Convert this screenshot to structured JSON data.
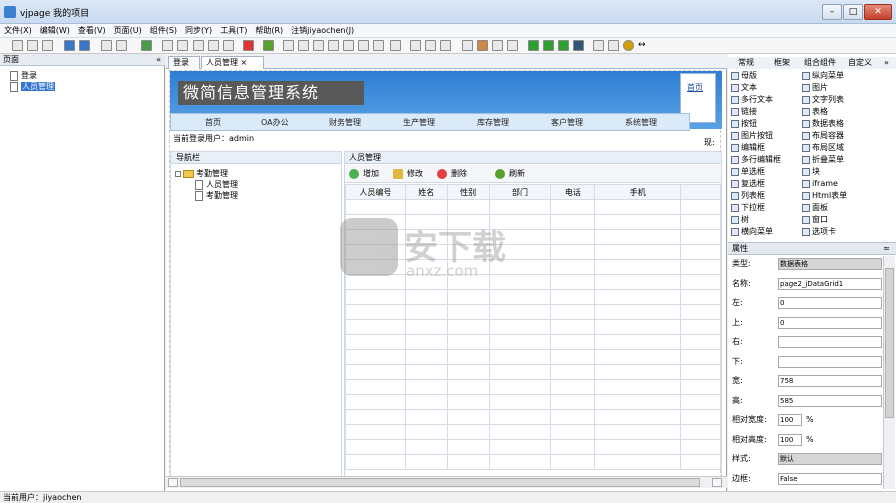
{
  "window": {
    "title": "vjpage 我的项目",
    "controls": [
      "–",
      "□",
      "✕"
    ]
  },
  "menu": [
    "文件(X)",
    "编辑(W)",
    "查看(V)",
    "页面(U)",
    "组件(S)",
    "同步(Y)",
    "工具(T)",
    "帮助(R)",
    "注销jiyaochen(J)"
  ],
  "left_panel": {
    "title": "页面",
    "collapse": "«",
    "items": [
      "登录",
      "人员管理"
    ]
  },
  "tabs": [
    {
      "label": "登录",
      "close": "×"
    },
    {
      "label": "人员管理",
      "close": "×"
    }
  ],
  "design": {
    "brand": "微简信息管理系统",
    "home_link": "首页",
    "nav": [
      "首页",
      "OA办公",
      "财务管理",
      "生产管理",
      "库存管理",
      "客户管理",
      "系统管理"
    ],
    "current_user": "当前登录用户：admin",
    "right_cut": "现:",
    "nav_panel": {
      "title": "导航栏",
      "root": "考勤管理",
      "children": [
        "人员管理",
        "考勤管理"
      ]
    },
    "grid_panel": {
      "title": "人员管理",
      "buttons": [
        "增加",
        "修改",
        "删除",
        "刷新"
      ],
      "columns": [
        "人员编号",
        "姓名",
        "性别",
        "部门",
        "电话",
        "手机"
      ]
    }
  },
  "right_panel": {
    "tabs": [
      "常规",
      "框架",
      "组合组件",
      "自定义"
    ],
    "more": "»",
    "components_col1": [
      "母版",
      "文本",
      "多行文本",
      "链接",
      "按钮",
      "图片按钮",
      "编辑框",
      "多行编辑框",
      "单选框",
      "复选框",
      "列表框",
      "下拉框",
      "树",
      "横向菜单"
    ],
    "components_col2": [
      "纵向菜单",
      "图片",
      "文字列表",
      "表格",
      "数据表格",
      "布局容器",
      "布局区域",
      "折叠菜单",
      "块",
      "iframe",
      "Html表单",
      "面板",
      "窗口",
      "选项卡"
    ],
    "properties_title": "属性",
    "properties": [
      {
        "label": "类型:",
        "value": "数据表格"
      },
      {
        "label": "名称:",
        "value": "page2_jDataGrid1"
      },
      {
        "label": "左:",
        "value": "0"
      },
      {
        "label": "上:",
        "value": "0"
      },
      {
        "label": "右:",
        "value": ""
      },
      {
        "label": "下:",
        "value": ""
      },
      {
        "label": "宽:",
        "value": "758"
      },
      {
        "label": "高:",
        "value": "585"
      },
      {
        "label": "相对宽度:",
        "value": "100",
        "unit": "%"
      },
      {
        "label": "相对高度:",
        "value": "100",
        "unit": "%"
      },
      {
        "label": "样式:",
        "value": "默认"
      },
      {
        "label": "边框:",
        "value": "False"
      }
    ]
  },
  "status": "当前用户：jiyaochen",
  "watermark": {
    "text": "安下载",
    "sub": "anxz.com"
  }
}
